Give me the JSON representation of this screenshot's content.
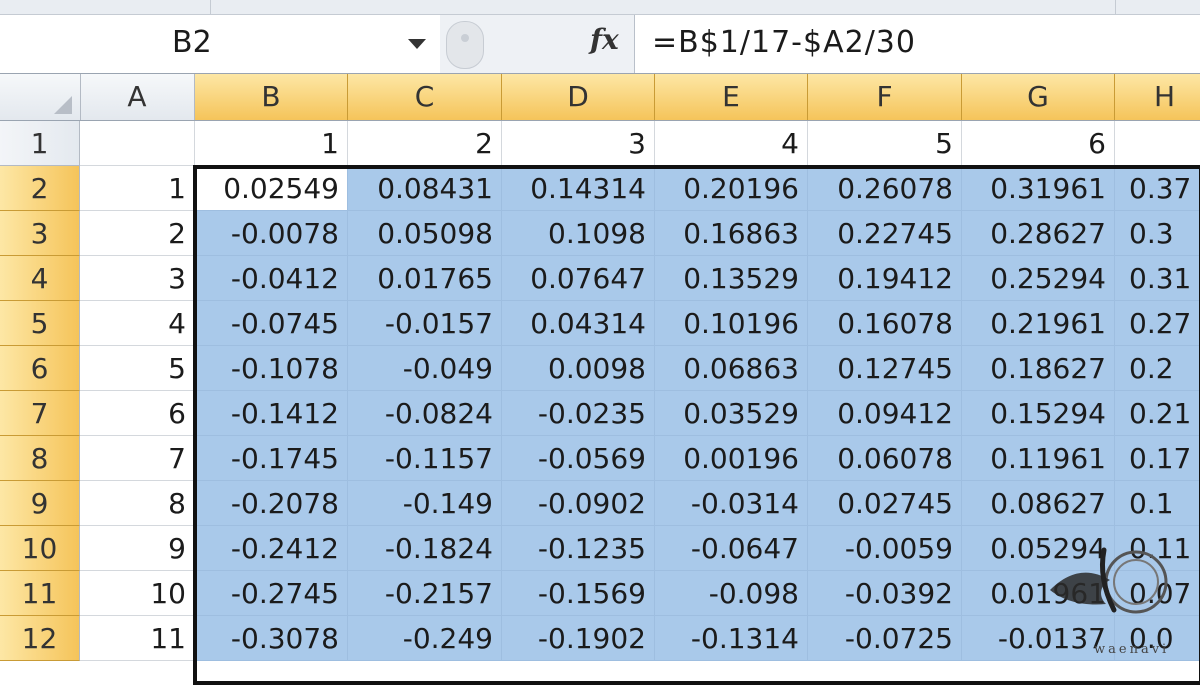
{
  "formula_bar": {
    "name_box": "B2",
    "fx_label": "fx",
    "formula": "=B$1/17-$A2/30"
  },
  "columns": [
    "A",
    "B",
    "C",
    "D",
    "E",
    "F",
    "G",
    "H"
  ],
  "selected_columns": [
    "B",
    "C",
    "D",
    "E",
    "F",
    "G",
    "H"
  ],
  "rows": [
    {
      "num": "1",
      "cells": [
        "",
        "1",
        "2",
        "3",
        "4",
        "5",
        "6",
        ""
      ]
    },
    {
      "num": "2",
      "cells": [
        "1",
        "0.02549",
        "0.08431",
        "0.14314",
        "0.20196",
        "0.26078",
        "0.31961",
        "0.37"
      ]
    },
    {
      "num": "3",
      "cells": [
        "2",
        "-0.0078",
        "0.05098",
        "0.1098",
        "0.16863",
        "0.22745",
        "0.28627",
        "0.3"
      ]
    },
    {
      "num": "4",
      "cells": [
        "3",
        "-0.0412",
        "0.01765",
        "0.07647",
        "0.13529",
        "0.19412",
        "0.25294",
        "0.31"
      ]
    },
    {
      "num": "5",
      "cells": [
        "4",
        "-0.0745",
        "-0.0157",
        "0.04314",
        "0.10196",
        "0.16078",
        "0.21961",
        "0.27"
      ]
    },
    {
      "num": "6",
      "cells": [
        "5",
        "-0.1078",
        "-0.049",
        "0.0098",
        "0.06863",
        "0.12745",
        "0.18627",
        "0.2"
      ]
    },
    {
      "num": "7",
      "cells": [
        "6",
        "-0.1412",
        "-0.0824",
        "-0.0235",
        "0.03529",
        "0.09412",
        "0.15294",
        "0.21"
      ]
    },
    {
      "num": "8",
      "cells": [
        "7",
        "-0.1745",
        "-0.1157",
        "-0.0569",
        "0.00196",
        "0.06078",
        "0.11961",
        "0.17"
      ]
    },
    {
      "num": "9",
      "cells": [
        "8",
        "-0.2078",
        "-0.149",
        "-0.0902",
        "-0.0314",
        "0.02745",
        "0.08627",
        "0.1"
      ]
    },
    {
      "num": "10",
      "cells": [
        "9",
        "-0.2412",
        "-0.1824",
        "-0.1235",
        "-0.0647",
        "-0.0059",
        "0.05294",
        "0.11"
      ]
    },
    {
      "num": "11",
      "cells": [
        "10",
        "-0.2745",
        "-0.2157",
        "-0.1569",
        "-0.098",
        "-0.0392",
        "0.01961",
        "0.07"
      ]
    },
    {
      "num": "12",
      "cells": [
        "11",
        "-0.3078",
        "-0.249",
        "-0.1902",
        "-0.1314",
        "-0.0725",
        "-0.0137",
        "0.0"
      ]
    }
  ],
  "watermark": {
    "text": "waenavi",
    "icon": "logo-icon"
  },
  "colors": {
    "selection_fill": "#a9c9ea",
    "header_highlight": "#f5c45a"
  }
}
